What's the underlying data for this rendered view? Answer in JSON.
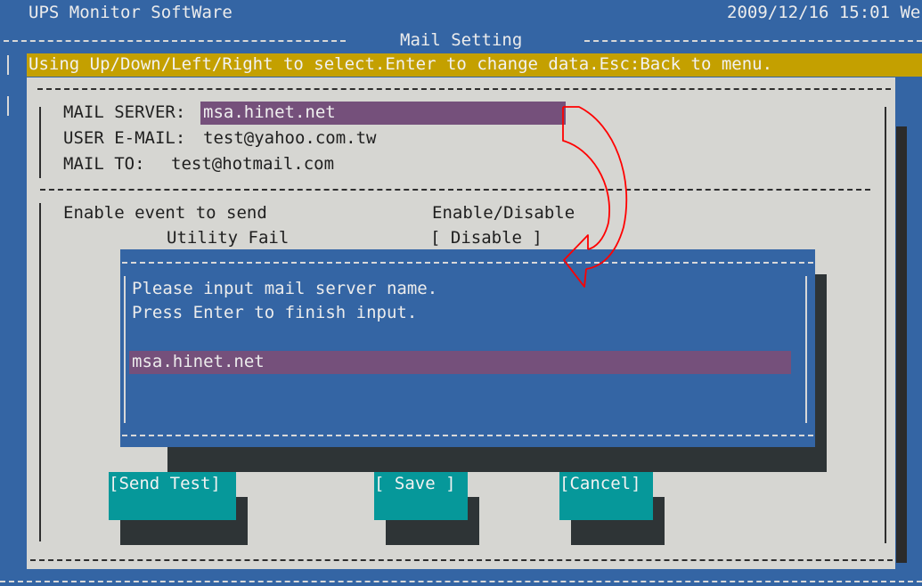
{
  "header": {
    "app_title": "UPS Monitor SoftWare",
    "datetime": "2009/12/16 15:01 We",
    "screen_title": "Mail Setting"
  },
  "help": {
    "text": "Using Up/Down/Left/Right to select.Enter to change data.Esc:Back to menu."
  },
  "fields": {
    "mail_server_label": "MAIL SERVER:",
    "mail_server_value": "msa.hinet.net",
    "user_email_label": "USER E-MAIL:",
    "user_email_value": "test@yahoo.com.tw",
    "mail_to_label": "MAIL TO:",
    "mail_to_value": "test@hotmail.com"
  },
  "events": {
    "header_label": "Enable event to send",
    "header_state": "Enable/Disable",
    "rows": [
      {
        "name": "Utility Fail",
        "state": "[ Disable ]"
      }
    ]
  },
  "dialog": {
    "line1": "Please input mail server name.",
    "line2": "Press Enter to finish input.",
    "input_value": "msa.hinet.net"
  },
  "buttons": {
    "send_test": "[Send Test]",
    "save": "[ Save ]",
    "cancel": "[Cancel]"
  },
  "colors": {
    "screen_bg": "#3465a4",
    "help_bar": "#c4a000",
    "panel_bg": "#d6d6d2",
    "highlight": "#75507b",
    "button": "#06989a",
    "annotation_arrow": "#ff0000"
  }
}
